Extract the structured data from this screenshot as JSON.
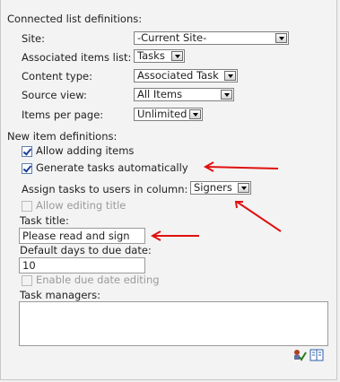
{
  "connected": {
    "heading": "Connected list definitions:",
    "site_label": "Site:",
    "site_value": "-Current Site-",
    "list_label": "Associated items list:",
    "list_value": "Tasks",
    "content_type_label": "Content type:",
    "content_type_value": "Associated Task",
    "source_view_label": "Source view:",
    "source_view_value": "All Items",
    "items_per_page_label": "Items per page:",
    "items_per_page_value": "Unlimited"
  },
  "new_item": {
    "heading": "New item definitions:",
    "allow_adding_label": "Allow adding items",
    "allow_adding_checked": true,
    "generate_tasks_label": "Generate tasks automatically",
    "generate_tasks_checked": true,
    "assign_label": "Assign tasks to users in column:",
    "assign_value": "Signers",
    "allow_editing_label": "Allow editing title",
    "task_title_label": "Task title:",
    "task_title_value": "Please read and sign",
    "days_label": "Default days to due date:",
    "days_value": "10",
    "enable_due_label": "Enable due date editing",
    "task_managers_label": "Task managers:",
    "task_managers_value": ""
  },
  "colors": {
    "annotation_arrow": "#e01010"
  },
  "icons": [
    "check-names-icon",
    "address-book-icon"
  ]
}
